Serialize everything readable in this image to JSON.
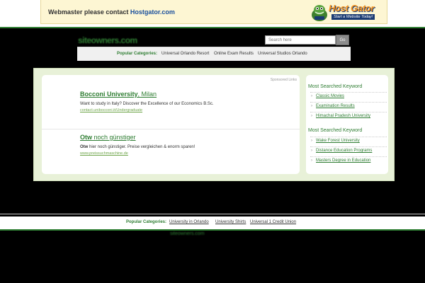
{
  "banner": {
    "text_prefix": "Webmaster please contact",
    "text_link": "Hostgator.com",
    "logo_name": "Host Gator",
    "logo_tagline": "Start a Website Today!"
  },
  "header": {
    "site_logo": "siteowners.com",
    "search_placeholder": "Search here",
    "search_button": "Go"
  },
  "categories": {
    "label": "Popular Categories:",
    "items": [
      "Universal Orlando Resort",
      "Online Exam Results",
      "Universal Studios Orlando"
    ]
  },
  "ads": {
    "sponsored_label": "Sponsored Links",
    "items": [
      {
        "title_bold": "Bocconi University",
        "title_rest": ", Milan",
        "title_prefix": "",
        "description": "Want to study in Italy? Discover the Excellence of our Economics B.Sc.",
        "url": "contact.unibocconi.it/Undergraduate"
      },
      {
        "title_bold": "Otw",
        "title_rest": " noch günstiger",
        "title_prefix": "",
        "description_bold": "Otw",
        "description": " hier noch günstiger. Preise vergleichen & enorm sparen!",
        "url": "www.preissuchmaschine.de"
      }
    ]
  },
  "sidebar": {
    "sections": [
      {
        "heading": "Most Searched Keyword",
        "items": [
          "Classic Movies",
          "Examination Results",
          "Himachal Pradesh University"
        ]
      },
      {
        "heading": "Most Searched Keyword",
        "items": [
          "Wake Forest University",
          "Distance Education Programs",
          "Masters Degree in Education"
        ]
      }
    ]
  },
  "footer": {
    "label": "Popular Categories:",
    "items": [
      "University in Orlando",
      "University Shirts",
      "Universal 1 Credit Union"
    ],
    "mark": "siteowners.com"
  },
  "colors": {
    "accent_green": "#2e7d32",
    "panel_bg": "#e8f1d8",
    "banner_bg": "#fdf6d3"
  }
}
